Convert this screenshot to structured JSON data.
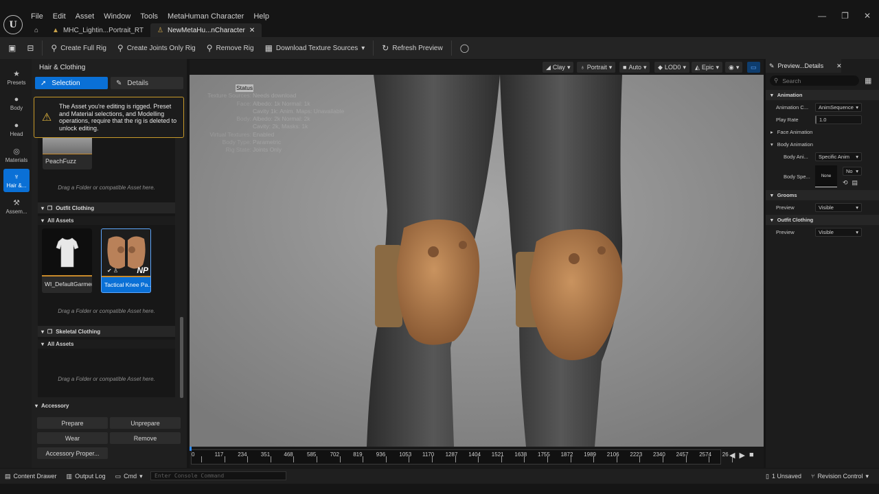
{
  "app": {
    "menu": [
      "File",
      "Edit",
      "Asset",
      "Window",
      "Tools",
      "MetaHuman Character",
      "Help"
    ],
    "logo": "U",
    "window_controls": [
      "—",
      "❐",
      "✕"
    ]
  },
  "tabs": [
    {
      "label": "MHC_Lightin...Portrait_RT",
      "active": false
    },
    {
      "label": "NewMetaHu...nCharacter",
      "active": true,
      "close": "✕"
    }
  ],
  "toolbar": {
    "create_full_rig": "Create Full Rig",
    "create_joints_only_rig": "Create Joints Only Rig",
    "remove_rig": "Remove Rig",
    "download_texture_sources": "Download Texture Sources",
    "refresh_preview": "Refresh Preview"
  },
  "leftnav": [
    {
      "label": "Presets",
      "icon": "★"
    },
    {
      "label": "Body",
      "icon": "●"
    },
    {
      "label": "Head",
      "icon": "●"
    },
    {
      "label": "Materials",
      "icon": "◎"
    },
    {
      "label": "Hair &...",
      "icon": "♆",
      "active": true
    },
    {
      "label": "Assem...",
      "icon": "⚒"
    }
  ],
  "left_panel": {
    "title": "Hair & Clothing",
    "segments": {
      "selection": "Selection",
      "details": "Details"
    },
    "warning": "The Asset you're editing is rigged. Preset and Material selections, and Modelling operations, require that the rig is deleted to unlock editing.",
    "peach_label": "PeachFuzz",
    "drop_hint": "Drag a Folder or compatible Asset here.",
    "outfit_section": "Outfit Clothing",
    "all_assets": "All Assets",
    "cards": [
      {
        "label": "WI_DefaultGarment"
      },
      {
        "label": "Tactical Knee Pa...",
        "selected": true,
        "badge": "NP"
      }
    ],
    "skeletal_section": "Skeletal Clothing",
    "accessory": {
      "title": "Accessory",
      "prepare": "Prepare",
      "unprepare": "Unprepare",
      "wear": "Wear",
      "remove": "Remove",
      "properties": "Accessory Proper..."
    }
  },
  "viewport": {
    "buttons": {
      "clay": "Clay",
      "portrait": "Portrait",
      "auto": "Auto",
      "lod": "LOD0",
      "quality": "Epic"
    },
    "status_title": "Status",
    "status": [
      {
        "k": "Texture Sources:",
        "v": "Needs download"
      },
      {
        "k": "Face:",
        "v": "Albedo: 1k Normal: 1k"
      },
      {
        "k": "",
        "v": "Cavity 1k: Anim. Maps: Unavailable"
      },
      {
        "k": "Body:",
        "v": "Albedo: 2k Normal: 2k"
      },
      {
        "k": "",
        "v": "Cavity: 2k, Masks: 1k"
      },
      {
        "k": "Virtual Textures:",
        "v": "Enabled"
      },
      {
        "k": "Body Type:",
        "v": "Parametric"
      },
      {
        "k": "Rig State:",
        "v": "Joints Only"
      }
    ]
  },
  "timeline": {
    "ticks": [
      "0",
      "117",
      "234",
      "351",
      "468",
      "585",
      "702",
      "819",
      "936",
      "1053",
      "1170",
      "1287",
      "1404",
      "1521",
      "1638",
      "1755",
      "1872",
      "1989",
      "2106",
      "2223",
      "2340",
      "2457",
      "2574",
      "26"
    ]
  },
  "details": {
    "tab": "Preview...Details",
    "search_placeholder": "Search",
    "sections": {
      "animation": "Animation",
      "face_animation": "Face Animation",
      "body_animation": "Body Animation",
      "grooms": "Grooms",
      "outfit_clothing": "Outfit Clothing"
    },
    "rows": {
      "animation_class_k": "Animation C...",
      "animation_class_v": "AnimSequence",
      "play_rate_k": "Play Rate",
      "play_rate_v": "1.0",
      "body_anim_k": "Body Ani...",
      "body_anim_v": "Specific Anim",
      "body_spec_k": "Body Spe...",
      "body_spec_thumb": "None",
      "body_spec_dd": "No",
      "grooms_preview_k": "Preview",
      "grooms_preview_v": "Visible",
      "outfit_preview_k": "Preview",
      "outfit_preview_v": "Visible"
    }
  },
  "bottombar": {
    "content_drawer": "Content Drawer",
    "output_log": "Output Log",
    "cmd": "Cmd",
    "console_placeholder": "Enter Console Command",
    "unsaved": "1 Unsaved",
    "revision_control": "Revision Control"
  }
}
